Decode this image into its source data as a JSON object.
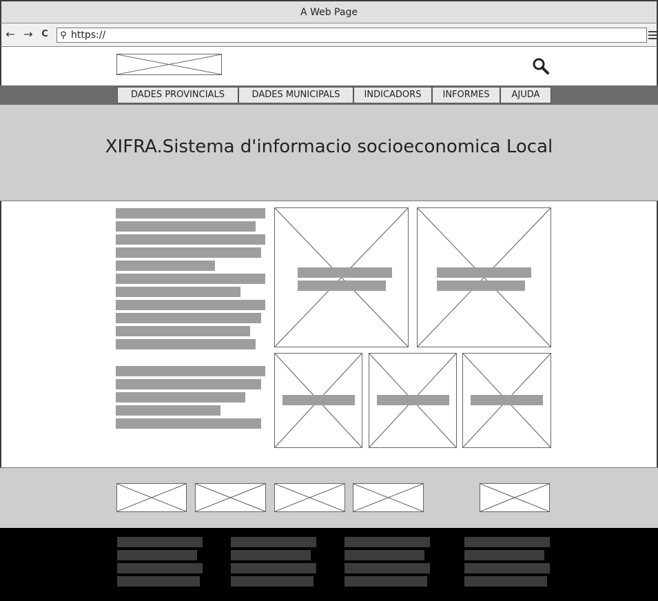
{
  "window": {
    "title": "A Web Page"
  },
  "browser": {
    "back_icon": "←",
    "forward_icon": "→",
    "reload_icon": "C",
    "url": "https://",
    "menu_icon": "hamburger-icon"
  },
  "header": {
    "logo": "logo-placeholder",
    "search_icon": "search-icon"
  },
  "nav": {
    "items": [
      {
        "label": "DADES PROVINCIALS"
      },
      {
        "label": "DADES MUNICIPALS"
      },
      {
        "label": "INDICADORS"
      },
      {
        "label": "INFORMES"
      },
      {
        "label": "AJUDA"
      }
    ]
  },
  "hero": {
    "title": "XIFRA.Sistema d'informacio socioeconomica Local"
  },
  "colors": {
    "menu_bar": "#6b6b6b",
    "hero_bg": "#cecece",
    "text_block": "#9e9e9e",
    "footer_dark": "#000000",
    "footer_bar": "#3c3c3c"
  }
}
